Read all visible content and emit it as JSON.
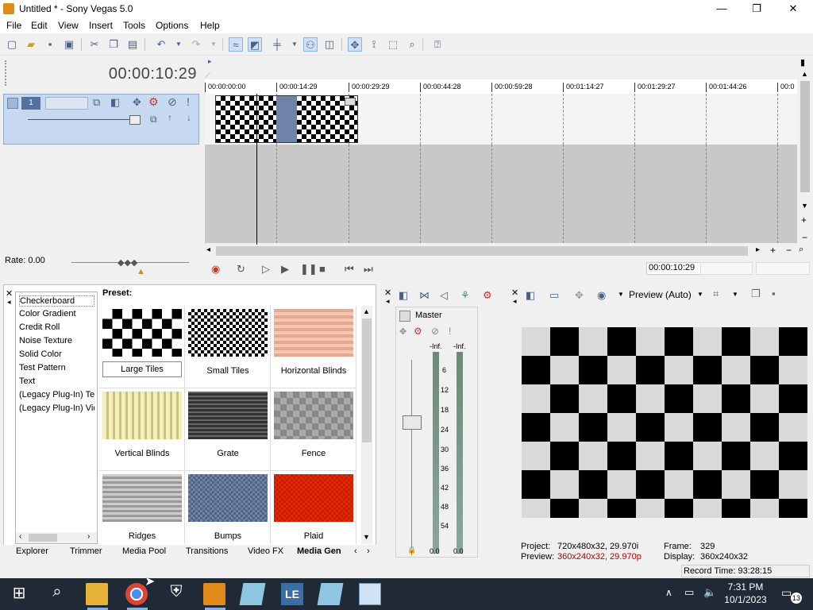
{
  "window": {
    "title": "Untitled * - Sony Vegas 5.0",
    "minimize": "—",
    "maximize": "❐",
    "close": "✕"
  },
  "menu": [
    "File",
    "Edit",
    "View",
    "Insert",
    "Tools",
    "Options",
    "Help"
  ],
  "timeline": {
    "timecode": "00:00:10:29",
    "ruler": [
      "00:00:00:00",
      "00:00:14:29",
      "00:00:29:29",
      "00:00:44:28",
      "00:00:59:28",
      "00:01:14:27",
      "00:01:29:27",
      "00:01:44:26",
      "00:0"
    ],
    "rate_label": "Rate: 0.00",
    "transport_timecode": "00:00:10:29"
  },
  "media_generators": {
    "list": [
      "Checkerboard",
      "Color Gradient",
      "Credit Roll",
      "Noise Texture",
      "Solid Color",
      "Test Pattern",
      "Text",
      "(Legacy Plug-In) Te",
      "(Legacy Plug-In) Vid"
    ],
    "preset_label": "Preset:",
    "presets": [
      "Large Tiles",
      "Small Tiles",
      "Horizontal Blinds",
      "Vertical Blinds",
      "Grate",
      "Fence",
      "Ridges",
      "Bumps",
      "Plaid"
    ]
  },
  "tabs": [
    "Explorer",
    "Trimmer",
    "Media Pool",
    "Transitions",
    "Video FX",
    "Media Gen"
  ],
  "mixer": {
    "label": "Master",
    "left_level": "-Inf.",
    "right_level": "-Inf.",
    "scale": [
      "6",
      "12",
      "18",
      "24",
      "30",
      "36",
      "42",
      "48",
      "54"
    ],
    "left_value": "0.0",
    "right_value": "0.0"
  },
  "preview": {
    "mode": "Preview (Auto)",
    "project_label": "Project:",
    "project_value": "720x480x32, 29.970i",
    "preview_label": "Preview:",
    "preview_value": "360x240x32, 29.970p",
    "frame_label": "Frame:",
    "frame_value": "329",
    "display_label": "Display:",
    "display_value": "360x240x32"
  },
  "status": {
    "record_time": "Record Time: 93:28:15"
  },
  "taskbar": {
    "time": "7:31 PM",
    "date": "10/1/2023",
    "notifications": "13"
  },
  "colors": {
    "track_header": "#c6d9f0",
    "accent": "#4a5f8a",
    "preview_red": "#b00000",
    "taskbar": "#1f2a36"
  }
}
